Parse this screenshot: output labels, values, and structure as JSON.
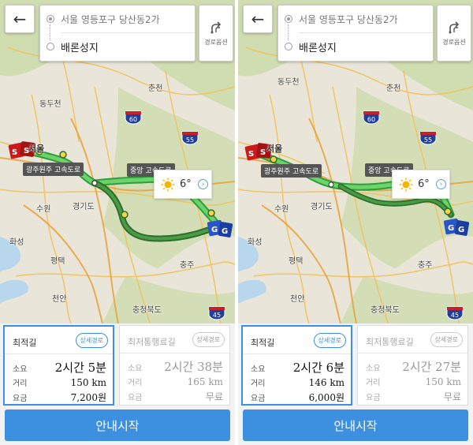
{
  "colors": {
    "accent": "#3d8fe0",
    "route_primary": "#2e9e3c",
    "route_secondary": "#3d8d3c",
    "origin_marker": "#cc1a1a",
    "dest_marker": "#2a55c7"
  },
  "screens": [
    {
      "header": {
        "back_icon": "arrow-left-icon",
        "origin": "서울 영등포구 당산동2가",
        "destination": "배론성지",
        "route_option_label": "경로옵션"
      },
      "map": {
        "cities": [
          "동두천",
          "춘천",
          "서울",
          "수원",
          "경기도",
          "화성",
          "평택",
          "천안",
          "충주",
          "충청북도"
        ],
        "road_labels": [
          "광주원주 고속도로",
          "중앙 고속도로"
        ],
        "highway_shields": [
          "60",
          "55",
          "45"
        ],
        "weather": {
          "temperature": "6°",
          "icon": "sun-icon"
        }
      },
      "routes": [
        {
          "title": "최적길",
          "detail_label": "상세경로",
          "selected": true,
          "time_label": "소요",
          "time_value": "2시간 5분",
          "distance_label": "거리",
          "distance_value": "150 km",
          "fare_label": "요금",
          "fare_value": "7,200원"
        },
        {
          "title": "최저통행료길",
          "detail_label": "상세경로",
          "selected": false,
          "time_label": "소요",
          "time_value": "2시간 38분",
          "distance_label": "거리",
          "distance_value": "165 km",
          "fare_label": "요금",
          "fare_value": "무료"
        }
      ],
      "start_label": "안내시작"
    },
    {
      "header": {
        "back_icon": "arrow-left-icon",
        "origin": "서울 영등포구 당산동2가",
        "destination": "배론성지",
        "route_option_label": "경로옵션"
      },
      "map": {
        "cities": [
          "동두천",
          "춘천",
          "서울",
          "수원",
          "경기도",
          "화성",
          "평택",
          "천안",
          "충주",
          "충청북도"
        ],
        "road_labels": [
          "광주원주 고속도로",
          "중앙 고속도로"
        ],
        "highway_shields": [
          "60",
          "55",
          "45"
        ],
        "weather": {
          "temperature": "6°",
          "icon": "sun-icon"
        }
      },
      "routes": [
        {
          "title": "최적길",
          "detail_label": "상세경로",
          "selected": true,
          "time_label": "소요",
          "time_value": "2시간 6분",
          "distance_label": "거리",
          "distance_value": "146 km",
          "fare_label": "요금",
          "fare_value": "6,000원"
        },
        {
          "title": "최저통행료길",
          "detail_label": "상세경로",
          "selected": false,
          "time_label": "소요",
          "time_value": "2시간 27분",
          "distance_label": "거리",
          "distance_value": "150 km",
          "fare_label": "요금",
          "fare_value": "무료"
        }
      ],
      "start_label": "안내시작"
    }
  ]
}
